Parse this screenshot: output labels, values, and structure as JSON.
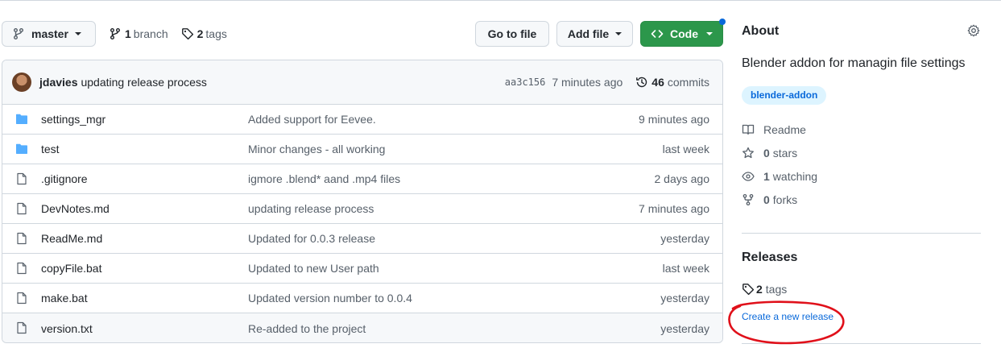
{
  "toolbar": {
    "branch": "master",
    "branch_count": "1",
    "branch_word": "branch",
    "tag_count": "2",
    "tag_word": "tags",
    "goto_file": "Go to file",
    "add_file": "Add file",
    "code": "Code"
  },
  "commit": {
    "author": "jdavies",
    "message": "updating release process",
    "sha": "aa3c156",
    "time": "7 minutes ago",
    "count": "46",
    "count_word": "commits"
  },
  "files": [
    {
      "type": "folder",
      "name": "settings_mgr",
      "message": "Added support for Eevee.",
      "age": "9 minutes ago"
    },
    {
      "type": "folder",
      "name": "test",
      "message": "Minor changes - all working",
      "age": "last week"
    },
    {
      "type": "file",
      "name": ".gitignore",
      "message": "igmore .blend* aand .mp4 files",
      "age": "2 days ago"
    },
    {
      "type": "file",
      "name": "DevNotes.md",
      "message": "updating release process",
      "age": "7 minutes ago"
    },
    {
      "type": "file",
      "name": "ReadMe.md",
      "message": "Updated for 0.0.3 release",
      "age": "yesterday"
    },
    {
      "type": "file",
      "name": "copyFile.bat",
      "message": "Updated to new User path",
      "age": "last week"
    },
    {
      "type": "file",
      "name": "make.bat",
      "message": "Updated version number to 0.0.4",
      "age": "yesterday"
    },
    {
      "type": "file",
      "name": "version.txt",
      "message": "Re-added to the project",
      "age": "yesterday"
    }
  ],
  "about": {
    "title": "About",
    "description": "Blender addon for managin file settings",
    "topic": "blender-addon",
    "readme": "Readme",
    "stars_count": "0",
    "stars_word": "stars",
    "watching_count": "1",
    "watching_word": "watching",
    "forks_count": "0",
    "forks_word": "forks"
  },
  "releases": {
    "title": "Releases",
    "tag_count": "2",
    "tag_word": "tags",
    "create_link": "Create a new release"
  },
  "colors": {
    "accent": "#0969da",
    "code_button": "#2c974b",
    "folder_icon": "#54aeff",
    "annotation": "#e0101a"
  }
}
